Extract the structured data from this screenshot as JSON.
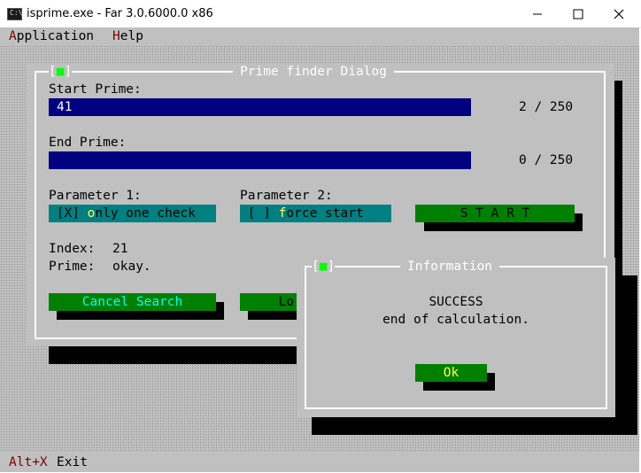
{
  "window": {
    "title": "isprime.exe - Far 3.0.6000.0 x86",
    "icon_text": "C:\\",
    "controls": {
      "minimize": "—",
      "maximize": "☐",
      "close": "✕"
    }
  },
  "menu": {
    "application": {
      "hotkey": "A",
      "rest": "pplication"
    },
    "help": {
      "hotkey": "H",
      "rest": "elp"
    }
  },
  "prime_dialog": {
    "title": "Prime finder Dialog",
    "close_marker": "[■]",
    "start_label": "Start Prime:",
    "start_value": "41",
    "start_counter": "2 / 250",
    "end_label": "End Prime:",
    "end_value": "",
    "end_counter": "0 / 250",
    "param1_label": "Parameter 1:",
    "param1_check": {
      "box": "[X] ",
      "hotkey": "o",
      "rest": "nly one check"
    },
    "param2_label": "Parameter 2:",
    "param2_check": {
      "box": "[ ] ",
      "hotkey": "f",
      "rest": "orce start"
    },
    "start_button": "S T A R T",
    "index_label": "Index:",
    "index_value": "21",
    "prime_label": "Prime:",
    "prime_value": "okay.",
    "cancel_button": "Cancel Search",
    "partial_button": "Lo"
  },
  "info_dialog": {
    "title": "Information",
    "close_marker": "[■]",
    "line1": "SUCCESS",
    "line2": "end of calculation.",
    "ok_button": "Ok"
  },
  "statusbar": {
    "key": "Alt+X",
    "action": "Exit"
  },
  "colors": {
    "console_bg": "#c0c0c0",
    "field_bg": "#000080",
    "check_bg": "#008080",
    "button_bg": "#008000",
    "hotkey": "#800000",
    "accent_text": "#ffff55",
    "marker_green": "#00ff00"
  }
}
